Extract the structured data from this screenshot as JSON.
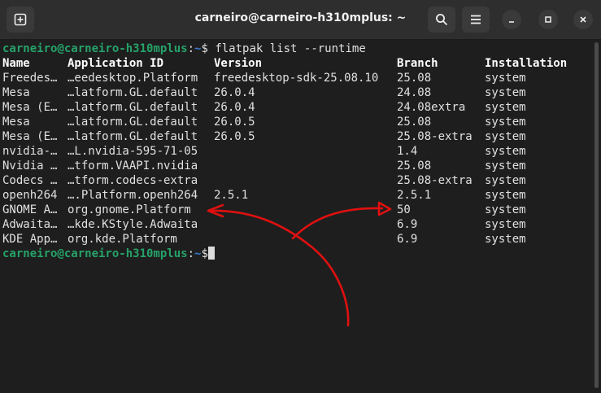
{
  "window": {
    "title": "carneiro@carneiro-h310mplus: ~",
    "icons": {
      "new_tab": "new-tab-icon",
      "search": "search-icon",
      "menu": "hamburger-menu-icon",
      "minimize": "minimize-icon",
      "maximize": "maximize-icon",
      "close": "close-icon"
    }
  },
  "terminal": {
    "prompt": {
      "user_host": "carneiro@carneiro-h310mplus",
      "separator": ":",
      "path": "~",
      "symbol": "$"
    },
    "command": " flatpak list --runtime",
    "headers": [
      "Name",
      "Application ID",
      "Version",
      "Branch",
      "Installation"
    ],
    "rows": [
      [
        "Freedes…",
        "…eedesktop.Platform",
        "freedesktop-sdk-25.08.10",
        "25.08",
        "system"
      ],
      [
        "Mesa",
        "…latform.GL.default",
        "26.0.4",
        "24.08",
        "system"
      ],
      [
        "Mesa (E…",
        "…latform.GL.default",
        "26.0.4",
        "24.08extra",
        "system"
      ],
      [
        "Mesa",
        "…latform.GL.default",
        "26.0.5",
        "25.08",
        "system"
      ],
      [
        "Mesa (E…",
        "…latform.GL.default",
        "26.0.5",
        "25.08-extra",
        "system"
      ],
      [
        "nvidia-…",
        "…L.nvidia-595-71-05",
        "",
        "1.4",
        "system"
      ],
      [
        "Nvidia …",
        "…tform.VAAPI.nvidia",
        "",
        "25.08",
        "system"
      ],
      [
        "Codecs …",
        "…tform.codecs-extra",
        "",
        "25.08-extra",
        "system"
      ],
      [
        "openh264",
        "….Platform.openh264",
        "2.5.1",
        "2.5.1",
        "system"
      ],
      [
        "GNOME A…",
        "org.gnome.Platform",
        "",
        "50",
        "system"
      ],
      [
        "Adwaita…",
        "…kde.KStyle.Adwaita",
        "",
        "6.9",
        "system"
      ],
      [
        "KDE App…",
        "org.kde.Platform",
        "",
        "6.9",
        "system"
      ]
    ]
  },
  "colors": {
    "background": "#1e1e1e",
    "titlebar": "#2e2e2e",
    "text": "#e0e0e0",
    "prompt_user": "#26a269",
    "prompt_path": "#3a7bd5",
    "annotation": "#e01010"
  },
  "annotation": {
    "description_icon": "red-hand-drawn-arrows"
  }
}
